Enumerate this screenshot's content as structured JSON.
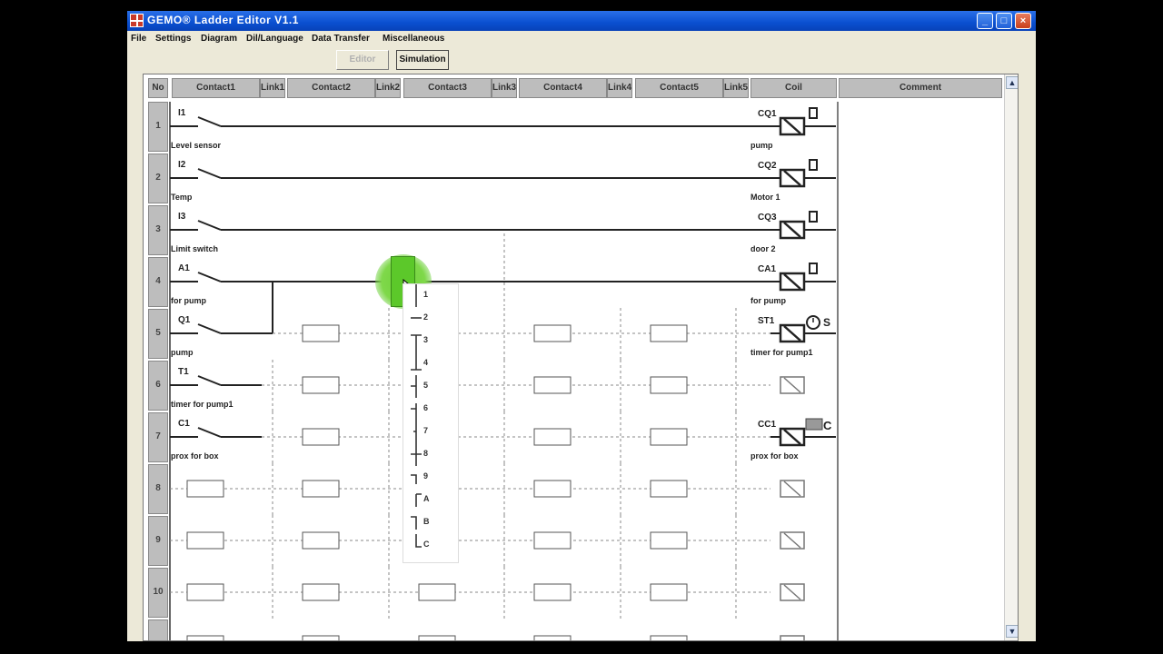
{
  "window": {
    "title": "GEMO® Ladder Editor V1.1",
    "controls": [
      "minimize",
      "maximize",
      "close"
    ]
  },
  "menu": [
    "File",
    "Settings",
    "Diagram",
    "Dil/Language",
    "Data Transfer",
    "Miscellaneous"
  ],
  "toolbar": {
    "editor_label": "Editor",
    "simulation_label": "Simulation"
  },
  "columns": [
    "No",
    "Contact1",
    "Link1",
    "Contact2",
    "Link2",
    "Contact3",
    "Link3",
    "Contact4",
    "Link4",
    "Contact5",
    "Link5",
    "Coil",
    "Comment"
  ],
  "rows": [
    {
      "no": "1",
      "contact": "I1",
      "contact_comment": "Level sensor",
      "coil": "CQ1",
      "coil_comment": "pump",
      "coil_icon": "battery-icon"
    },
    {
      "no": "2",
      "contact": "I2",
      "contact_comment": "Temp",
      "coil": "CQ2",
      "coil_comment": "Motor 1",
      "coil_icon": "battery-icon"
    },
    {
      "no": "3",
      "contact": "I3",
      "contact_comment": "Limit switch",
      "coil": "CQ3",
      "coil_comment": "door 2",
      "coil_icon": "battery-icon"
    },
    {
      "no": "4",
      "contact": "A1",
      "contact_comment": "for pump",
      "coil": "CA1",
      "coil_comment": "for pump",
      "coil_icon": "battery-icon"
    },
    {
      "no": "5",
      "contact": "Q1",
      "contact_comment": "pump",
      "coil": "ST1",
      "coil_comment": "timer for pump1",
      "coil_icon": "clock-icon",
      "coil_icon_text": "S"
    },
    {
      "no": "6",
      "contact": "T1",
      "contact_comment": "timer for pump1",
      "coil": "",
      "coil_comment": ""
    },
    {
      "no": "7",
      "contact": "C1",
      "contact_comment": "prox for box",
      "coil": "CC1",
      "coil_comment": "prox for box",
      "coil_icon": "counter-icon",
      "coil_icon_text": "C"
    },
    {
      "no": "8",
      "contact": "",
      "contact_comment": "",
      "coil": "",
      "coil_comment": ""
    },
    {
      "no": "9",
      "contact": "",
      "contact_comment": "",
      "coil": "",
      "coil_comment": ""
    },
    {
      "no": "10",
      "contact": "",
      "contact_comment": "",
      "coil": "",
      "coil_comment": ""
    }
  ],
  "link_popup": {
    "items": [
      {
        "num": "1",
        "glyph": "link-vertical-icon"
      },
      {
        "num": "2",
        "glyph": "link-horizontal-icon"
      },
      {
        "num": "3",
        "glyph": "link-t-down-icon"
      },
      {
        "num": "4",
        "glyph": "link-t-up-icon"
      },
      {
        "num": "5",
        "glyph": "link-left-branch-icon"
      },
      {
        "num": "6",
        "glyph": "link-left-branch-down-icon"
      },
      {
        "num": "7",
        "glyph": "link-left-vertical-icon"
      },
      {
        "num": "8",
        "glyph": "link-cross-icon"
      },
      {
        "num": "9",
        "glyph": "link-corner-down-icon"
      },
      {
        "num": "A",
        "glyph": "link-corner-right-icon"
      },
      {
        "num": "B",
        "glyph": "link-corner-left-icon"
      },
      {
        "num": "C",
        "glyph": "link-corner-up-icon"
      }
    ]
  }
}
